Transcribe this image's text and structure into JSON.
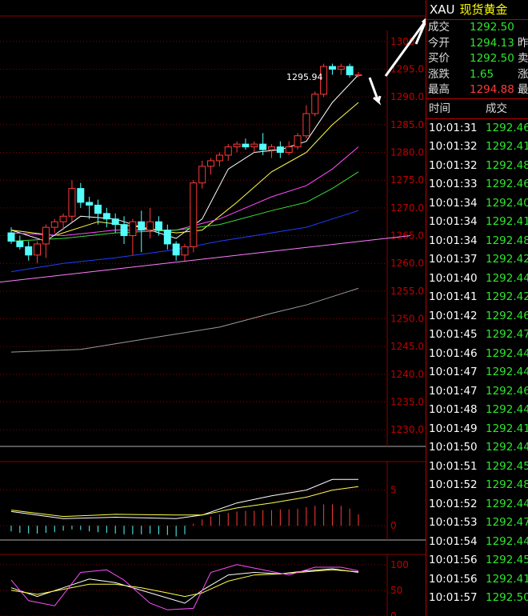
{
  "colors": {
    "up": "#ff3a3a",
    "down": "#54fcfc",
    "grid": "#8a0000",
    "axis_text": "#c00000",
    "ma5": "#ffffff",
    "ma10": "#ffff4a",
    "ma20": "#ff4dff",
    "ma30": "#3cdc3c",
    "ma60": "#1f3dff",
    "ma120": "#ff7fff",
    "ma250": "#9a9a9a",
    "price_green": "#2ee62e",
    "price_red": "#ff3a3a"
  },
  "quote": {
    "symbol": "XAU",
    "name": "现货黄金",
    "rows": [
      {
        "label": "成交",
        "value": "1292.50",
        "value_color": "#2ee62e",
        "label2": ""
      },
      {
        "label": "今开",
        "value": "1294.13",
        "value_color": "#2ee62e",
        "label2": "昨"
      },
      {
        "label": "买价",
        "value": "1292.50",
        "value_color": "#2ee62e",
        "label2": "卖"
      },
      {
        "label": "涨跌",
        "value": "1.65",
        "value_color": "#2ee62e",
        "label2": "涨"
      },
      {
        "label": "最高",
        "value": "1294.88",
        "value_color": "#ff3a3a",
        "label2": "最"
      }
    ]
  },
  "ticks": {
    "header_time": "时间",
    "header_price": "成交",
    "rows": [
      {
        "time": "10:01:31",
        "price": "1292.46"
      },
      {
        "time": "10:01:32",
        "price": "1292.41"
      },
      {
        "time": "10:01:32",
        "price": "1292.48"
      },
      {
        "time": "10:01:33",
        "price": "1292.46"
      },
      {
        "time": "10:01:34",
        "price": "1292.40"
      },
      {
        "time": "10:01:34",
        "price": "1292.41"
      },
      {
        "time": "10:01:34",
        "price": "1292.48"
      },
      {
        "time": "10:01:37",
        "price": "1292.42"
      },
      {
        "time": "10:01:40",
        "price": "1292.44"
      },
      {
        "time": "10:01:41",
        "price": "1292.42"
      },
      {
        "time": "10:01:42",
        "price": "1292.46"
      },
      {
        "time": "10:01:45",
        "price": "1292.47"
      },
      {
        "time": "10:01:46",
        "price": "1292.44"
      },
      {
        "time": "10:01:47",
        "price": "1292.44"
      },
      {
        "time": "10:01:47",
        "price": "1292.46"
      },
      {
        "time": "10:01:48",
        "price": "1292.44"
      },
      {
        "time": "10:01:49",
        "price": "1292.41"
      },
      {
        "time": "10:01:50",
        "price": "1292.44"
      },
      {
        "time": "10:01:51",
        "price": "1292.45"
      },
      {
        "time": "10:01:52",
        "price": "1292.48"
      },
      {
        "time": "10:01:52",
        "price": "1292.44"
      },
      {
        "time": "10:01:53",
        "price": "1292.47"
      },
      {
        "time": "10:01:54",
        "price": "1292.44"
      },
      {
        "time": "10:01:56",
        "price": "1292.45"
      },
      {
        "time": "10:01:56",
        "price": "1292.41"
      },
      {
        "time": "10:01:57",
        "price": "1292.50"
      }
    ]
  },
  "chart_data": [
    {
      "type": "candlestick",
      "title": "",
      "ylim": [
        1227,
        1302
      ],
      "y_ticks": [
        1230,
        1235,
        1240,
        1245,
        1250,
        1255,
        1260,
        1265,
        1270,
        1275,
        1280,
        1285,
        1290,
        1295,
        1300
      ],
      "y_tick_labels": [
        "1230.0",
        "1235.0",
        "1240.0",
        "1245.0",
        "1250.0",
        "1255.0",
        "1260.0",
        "1265.0",
        "1270.0",
        "1275.0",
        "1280.0",
        "1285.0",
        "1290.0",
        "1295.0",
        "1300"
      ],
      "annotation": {
        "text": "1295.94",
        "candle_index": 33
      },
      "ohlc": [
        [
          1265.5,
          1266.5,
          1263.5,
          1264.0
        ],
        [
          1264.0,
          1265.0,
          1262.5,
          1263.0
        ],
        [
          1263.0,
          1264.0,
          1260.5,
          1261.5
        ],
        [
          1261.5,
          1264.0,
          1260.0,
          1263.5
        ],
        [
          1263.5,
          1267.0,
          1261.0,
          1266.5
        ],
        [
          1266.5,
          1268.0,
          1265.5,
          1267.5
        ],
        [
          1267.5,
          1269.0,
          1266.0,
          1268.5
        ],
        [
          1268.5,
          1275.0,
          1267.5,
          1273.5
        ],
        [
          1273.5,
          1274.5,
          1270.0,
          1271.0
        ],
        [
          1271.0,
          1272.0,
          1268.0,
          1270.5
        ],
        [
          1270.5,
          1271.5,
          1267.0,
          1269.0
        ],
        [
          1269.0,
          1270.0,
          1266.5,
          1268.0
        ],
        [
          1268.0,
          1269.0,
          1265.5,
          1267.0
        ],
        [
          1267.0,
          1268.5,
          1263.5,
          1265.0
        ],
        [
          1265.0,
          1268.0,
          1261.5,
          1267.5
        ],
        [
          1267.5,
          1269.5,
          1262.0,
          1266.0
        ],
        [
          1266.0,
          1270.0,
          1264.5,
          1267.5
        ],
        [
          1267.5,
          1268.5,
          1265.0,
          1266.0
        ],
        [
          1266.0,
          1267.0,
          1262.5,
          1263.5
        ],
        [
          1263.5,
          1264.0,
          1260.5,
          1261.5
        ],
        [
          1261.5,
          1263.5,
          1260.5,
          1263.0
        ],
        [
          1263.0,
          1275.0,
          1262.0,
          1274.5
        ],
        [
          1274.5,
          1278.5,
          1273.5,
          1277.5
        ],
        [
          1277.5,
          1279.0,
          1276.0,
          1278.5
        ],
        [
          1278.5,
          1280.0,
          1277.5,
          1279.5
        ],
        [
          1279.5,
          1281.5,
          1278.5,
          1281.0
        ],
        [
          1281.0,
          1282.0,
          1280.0,
          1281.5
        ],
        [
          1281.5,
          1282.5,
          1280.5,
          1281.0
        ],
        [
          1281.0,
          1282.0,
          1280.0,
          1281.5
        ],
        [
          1281.5,
          1283.5,
          1279.5,
          1280.5
        ],
        [
          1280.5,
          1281.5,
          1279.0,
          1281.0
        ],
        [
          1281.0,
          1282.0,
          1279.0,
          1280.0
        ],
        [
          1280.0,
          1282.0,
          1279.5,
          1281.0
        ],
        [
          1281.0,
          1283.5,
          1280.5,
          1283.0
        ],
        [
          1283.0,
          1288.5,
          1282.5,
          1287.0
        ],
        [
          1287.0,
          1291.0,
          1286.5,
          1290.5
        ],
        [
          1290.5,
          1296.0,
          1290.0,
          1295.5
        ],
        [
          1295.5,
          1296.0,
          1294.0,
          1295.0
        ],
        [
          1295.0,
          1296.0,
          1294.0,
          1295.5
        ],
        [
          1295.5,
          1296.0,
          1293.5,
          1294.0
        ],
        [
          1294.0,
          1294.5,
          1293.5,
          1294.0
        ]
      ],
      "moving_averages": [
        {
          "key": "ma5",
          "points": [
            [
              0,
              1266
            ],
            [
              4,
              1264
            ],
            [
              8,
              1268.5
            ],
            [
              12,
              1268
            ],
            [
              16,
              1266
            ],
            [
              19,
              1264.5
            ],
            [
              22,
              1268
            ],
            [
              25,
              1277
            ],
            [
              28,
              1280
            ],
            [
              31,
              1280.5
            ],
            [
              34,
              1282
            ],
            [
              37,
              1289
            ],
            [
              40,
              1294
            ]
          ]
        },
        {
          "key": "ma10",
          "points": [
            [
              0,
              1266
            ],
            [
              5,
              1265
            ],
            [
              10,
              1267.5
            ],
            [
              15,
              1266.5
            ],
            [
              19,
              1265.5
            ],
            [
              22,
              1266
            ],
            [
              26,
              1271
            ],
            [
              30,
              1276.5
            ],
            [
              34,
              1280
            ],
            [
              37,
              1285
            ],
            [
              40,
              1289
            ]
          ]
        },
        {
          "key": "ma20",
          "points": [
            [
              0,
              1265.5
            ],
            [
              6,
              1265
            ],
            [
              12,
              1266
            ],
            [
              19,
              1266
            ],
            [
              24,
              1268
            ],
            [
              30,
              1272
            ],
            [
              34,
              1274
            ],
            [
              37,
              1277
            ],
            [
              40,
              1281
            ]
          ]
        },
        {
          "key": "ma30",
          "points": [
            [
              0,
              1264
            ],
            [
              6,
              1264.5
            ],
            [
              12,
              1265.5
            ],
            [
              19,
              1266
            ],
            [
              24,
              1267
            ],
            [
              30,
              1269.5
            ],
            [
              34,
              1271
            ],
            [
              37,
              1273.5
            ],
            [
              40,
              1276.5
            ]
          ]
        },
        {
          "key": "ma60",
          "points": [
            [
              0,
              1258.5
            ],
            [
              6,
              1260
            ],
            [
              12,
              1261
            ],
            [
              19,
              1262.5
            ],
            [
              24,
              1264
            ],
            [
              30,
              1265.5
            ],
            [
              34,
              1266.5
            ],
            [
              37,
              1268
            ],
            [
              40,
              1269.5
            ]
          ]
        },
        {
          "key": "ma120",
          "points": [
            [
              -2,
              1256.5
            ],
            [
              46,
              1265
            ]
          ]
        },
        {
          "key": "ma250",
          "points": [
            [
              0,
              1244
            ],
            [
              8,
              1244.5
            ],
            [
              16,
              1246.5
            ],
            [
              24,
              1248.5
            ],
            [
              30,
              1251
            ],
            [
              34,
              1252.5
            ],
            [
              38,
              1254.5
            ],
            [
              40,
              1255.5
            ]
          ]
        }
      ]
    },
    {
      "type": "macd",
      "title": "",
      "ylim": [
        -2,
        9
      ],
      "y_ticks": [
        0,
        5
      ],
      "y_tick_labels": [
        "0",
        "5"
      ],
      "histogram": [
        -0.8,
        -1.0,
        -1.1,
        -1.1,
        -1.0,
        -0.9,
        -0.7,
        -0.5,
        -0.6,
        -0.8,
        -0.9,
        -1.0,
        -1.1,
        -1.2,
        -1.2,
        -1.2,
        -1.1,
        -1.2,
        -1.3,
        -1.5,
        -1.2,
        0.3,
        0.9,
        1.3,
        1.6,
        1.8,
        2.0,
        2.1,
        2.1,
        2.2,
        2.2,
        2.3,
        2.3,
        2.4,
        2.6,
        2.8,
        3.0,
        3.0,
        2.8,
        2.4,
        1.6
      ],
      "lines": [
        {
          "key": "ma5",
          "points": [
            [
              0,
              2
            ],
            [
              6,
              1
            ],
            [
              12,
              1.2
            ],
            [
              19,
              1
            ],
            [
              22,
              1.5
            ],
            [
              26,
              3.2
            ],
            [
              30,
              4.2
            ],
            [
              34,
              5
            ],
            [
              37,
              6.5
            ],
            [
              40,
              6.5
            ]
          ]
        },
        {
          "key": "ma10",
          "points": [
            [
              0,
              2.2
            ],
            [
              6,
              1.3
            ],
            [
              12,
              1.6
            ],
            [
              19,
              1.5
            ],
            [
              22,
              1.5
            ],
            [
              26,
              2.5
            ],
            [
              30,
              3.2
            ],
            [
              34,
              4
            ],
            [
              37,
              5
            ],
            [
              40,
              5.5
            ]
          ]
        }
      ]
    },
    {
      "type": "kdj",
      "title": "",
      "ylim": [
        0,
        120
      ],
      "y_ticks": [
        0,
        50,
        100
      ],
      "y_tick_labels": [
        "0",
        "50",
        "100"
      ],
      "lines": [
        {
          "key": "ma5",
          "points": [
            [
              0,
              55
            ],
            [
              3,
              38
            ],
            [
              6,
              55
            ],
            [
              9,
              72
            ],
            [
              12,
              65
            ],
            [
              15,
              50
            ],
            [
              18,
              35
            ],
            [
              20,
              25
            ],
            [
              22,
              50
            ],
            [
              25,
              80
            ],
            [
              28,
              85
            ],
            [
              31,
              82
            ],
            [
              34,
              88
            ],
            [
              37,
              92
            ],
            [
              40,
              85
            ]
          ]
        },
        {
          "key": "ma10",
          "points": [
            [
              0,
              50
            ],
            [
              3,
              42
            ],
            [
              6,
              52
            ],
            [
              9,
              62
            ],
            [
              12,
              62
            ],
            [
              15,
              55
            ],
            [
              18,
              45
            ],
            [
              20,
              38
            ],
            [
              22,
              45
            ],
            [
              25,
              68
            ],
            [
              28,
              80
            ],
            [
              31,
              82
            ],
            [
              34,
              86
            ],
            [
              37,
              90
            ],
            [
              40,
              86
            ]
          ]
        },
        {
          "key": "ma20",
          "points": [
            [
              0,
              70
            ],
            [
              2,
              30
            ],
            [
              5,
              20
            ],
            [
              8,
              85
            ],
            [
              11,
              90
            ],
            [
              13,
              70
            ],
            [
              16,
              25
            ],
            [
              18,
              12
            ],
            [
              21,
              15
            ],
            [
              23,
              85
            ],
            [
              26,
              100
            ],
            [
              29,
              90
            ],
            [
              32,
              80
            ],
            [
              35,
              95
            ],
            [
              38,
              95
            ],
            [
              40,
              88
            ]
          ]
        }
      ]
    }
  ]
}
